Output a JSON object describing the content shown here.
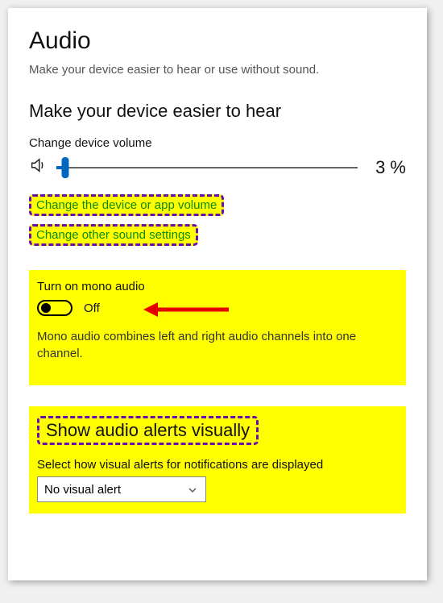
{
  "page": {
    "title": "Audio",
    "subtitle": "Make your device easier to hear or use without sound."
  },
  "hear": {
    "heading": "Make your device easier to hear",
    "volume_label": "Change device volume",
    "volume_percent": 3,
    "volume_display": "3 %",
    "link_change_volume": "Change the device or app volume",
    "link_other_sound": "Change other sound settings"
  },
  "mono": {
    "label": "Turn on mono audio",
    "state": "Off",
    "description": "Mono audio combines left and right audio channels into one channel."
  },
  "visual": {
    "heading": "Show audio alerts visually",
    "select_label": "Select how visual alerts for notifications are displayed",
    "selected": "No visual alert"
  },
  "colors": {
    "highlight": "#ffff00",
    "dash_border": "#6a0dad",
    "link_green": "#0a8a0a",
    "accent_blue": "#0067c0",
    "arrow_red": "#e60000"
  }
}
